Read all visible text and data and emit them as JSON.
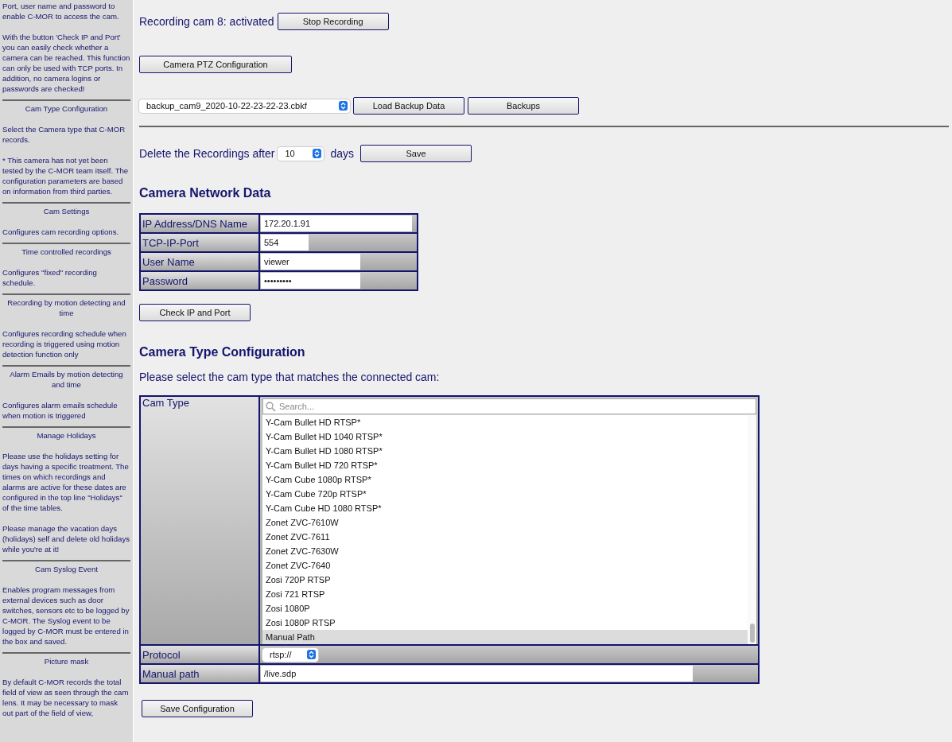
{
  "sidebar": {
    "sections": [
      {
        "paragraphs": [
          "Port, user name and password to enable C-MOR to access the cam.",
          "With the button 'Check IP and Port' you can easily check whether a camera can be reached. This function can only be used with TCP ports. In addition, no camera logins or passwords are checked!"
        ]
      },
      {
        "title": "Cam Type Configuration",
        "paragraphs": [
          "Select the Camera type that C-MOR records.",
          "* This camera has not yet been tested by the C-MOR team itself. The configuration parameters are based on information from third parties."
        ]
      },
      {
        "title": "Cam Settings",
        "paragraphs": [
          "Configures cam recording options."
        ]
      },
      {
        "title": "Time controlled recordings",
        "paragraphs": [
          "Configures \"fixed\" recording schedule."
        ]
      },
      {
        "title": "Recording by motion detecting and time",
        "paragraphs": [
          "Configures recording schedule when recording is triggered using motion detection function only"
        ]
      },
      {
        "title": "Alarm Emails by motion detecting and time",
        "paragraphs": [
          "Configures alarm emails schedule when motion is triggered"
        ]
      },
      {
        "title": "Manage Holidays",
        "paragraphs": [
          "Please use the holidays setting for days having a specific treatment. The times on which recordings and alarms are active for these dates are configured in the top line \"Holidays\" of the time tables.",
          "Please manage the vacation days (holidays) self and delete old holidays while you're at it!"
        ]
      },
      {
        "title": "Cam Syslog Event",
        "paragraphs": [
          "Enables program messages from external devices such as door switches, sensors etc to be logged by C-MOR. The Syslog event to be logged by C-MOR must be entered in the box and saved."
        ]
      },
      {
        "title": "Picture mask",
        "paragraphs": [
          "By default C-MOR records the total field of view as seen through the cam lens. It may be necessary to mask out part of the field of view,"
        ]
      }
    ]
  },
  "recording": {
    "status": "Recording cam 8: activated",
    "button": "Stop Recording"
  },
  "ptz_button": "Camera PTZ Configuration",
  "backup": {
    "file": "backup_cam9_2020-10-22-23-22-23.cbkf",
    "load_button": "Load Backup Data",
    "backups_button": "Backups"
  },
  "retention": {
    "label": "Delete the Recordings after",
    "value": "10",
    "unit": "days",
    "save_button": "Save"
  },
  "network": {
    "heading": "Camera Network Data",
    "rows": [
      {
        "label": "IP Address/DNS Name",
        "value": "172.20.1.91"
      },
      {
        "label": "TCP-IP-Port",
        "value": "554"
      },
      {
        "label": "User Name",
        "value": "viewer"
      },
      {
        "label": "Password",
        "value": "•••••••••"
      }
    ],
    "check_button": "Check IP and Port"
  },
  "cam_type": {
    "heading": "Camera Type Configuration",
    "instruction": "Please select the cam type that matches the connected cam:",
    "label": "Cam Type",
    "search_placeholder": "Search...",
    "items": [
      {
        "label": "Y-Cam Bullet HD RTSP*",
        "selected": false
      },
      {
        "label": "Y-Cam Bullet HD 1040 RTSP*",
        "selected": false
      },
      {
        "label": "Y-Cam Bullet HD 1080 RTSP*",
        "selected": false
      },
      {
        "label": "Y-Cam Bullet HD 720 RTSP*",
        "selected": false
      },
      {
        "label": "Y-Cam Cube 1080p RTSP*",
        "selected": false
      },
      {
        "label": "Y-Cam Cube 720p RTSP*",
        "selected": false
      },
      {
        "label": "Y-Cam Cube HD 1080 RTSP*",
        "selected": false
      },
      {
        "label": "Zonet ZVC-7610W",
        "selected": false
      },
      {
        "label": "Zonet ZVC-7611",
        "selected": false
      },
      {
        "label": "Zonet ZVC-7630W",
        "selected": false
      },
      {
        "label": "Zonet ZVC-7640",
        "selected": false
      },
      {
        "label": "Zosi 720P RTSP",
        "selected": false
      },
      {
        "label": "Zosi 721 RTSP",
        "selected": false
      },
      {
        "label": "Zosi 1080P",
        "selected": false
      },
      {
        "label": "Zosi 1080P RTSP",
        "selected": false
      },
      {
        "label": "Manual Path",
        "selected": true
      }
    ],
    "protocol_label": "Protocol",
    "protocol_value": "rtsp://",
    "manual_path_label": "Manual path",
    "manual_path_value": "/live.sdp"
  },
  "save_button": "Save Configuration"
}
